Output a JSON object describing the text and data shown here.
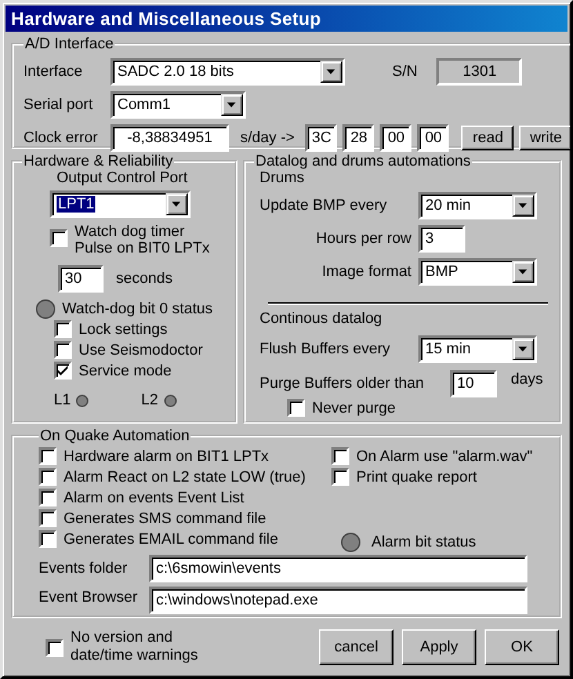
{
  "window": {
    "title": "Hardware and Miscellaneous Setup"
  },
  "ad_interface": {
    "title": "A/D Interface",
    "interface": {
      "label": "Interface",
      "value": "SADC 2.0 18 bits"
    },
    "sn": {
      "label": "S/N",
      "value": "1301"
    },
    "serial_port": {
      "label": "Serial port",
      "value": "Comm1"
    },
    "clock_error": {
      "label": "Clock error",
      "value": "-8,38834951",
      "unit": "s/day ->",
      "bytes": [
        "3C",
        "28",
        "00",
        "00"
      ]
    },
    "buttons": [
      "read",
      "write"
    ]
  },
  "hardware": {
    "title": "Hardware & Reliability",
    "port_label": "Output Control Port",
    "port_value": "LPT1",
    "watchdog": {
      "label": "Watch dog timer Pulse on BIT0 LPTx",
      "checked": false
    },
    "seconds": {
      "value": "30",
      "unit": "seconds"
    },
    "status_label": "Watch-dog bit 0 status",
    "options": [
      {
        "label": "Lock settings",
        "checked": false
      },
      {
        "label": "Use Seismodoctor",
        "checked": false
      },
      {
        "label": "Service mode",
        "checked": true
      }
    ],
    "leds": [
      "L1",
      "L2"
    ]
  },
  "datalog": {
    "title": "Datalog and drums automations",
    "drums_label": "Drums",
    "update": {
      "label": "Update BMP every",
      "value": "20 min"
    },
    "hours": {
      "label": "Hours per row",
      "value": "3"
    },
    "image_format": {
      "label": "Image format",
      "value": "BMP"
    },
    "continuous_label": "Continous datalog",
    "flush": {
      "label": "Flush Buffers every",
      "value": "15 min"
    },
    "purge": {
      "label": "Purge Buffers older than",
      "value": "10",
      "unit": "days"
    },
    "never_purge": {
      "label": "Never purge",
      "checked": false
    }
  },
  "quake": {
    "title": "On Quake Automation",
    "left_options": [
      {
        "label": "Hardware alarm on BIT1 LPTx",
        "checked": false
      },
      {
        "label": "Alarm React on L2 state LOW (true)",
        "checked": false
      },
      {
        "label": "Alarm on events Event List",
        "checked": false
      },
      {
        "label": "Generates SMS command file",
        "checked": false
      },
      {
        "label": "Generates EMAIL command file",
        "checked": false
      }
    ],
    "right_options": [
      {
        "label": "On Alarm use \"alarm.wav\"",
        "checked": false
      },
      {
        "label": "Print quake report",
        "checked": false
      }
    ],
    "status_label": "Alarm bit status",
    "events_folder": {
      "label": "Events folder",
      "value": "c:\\6smowin\\events"
    },
    "event_browser": {
      "label": "Event Browser",
      "value": "c:\\windows\\notepad.exe"
    }
  },
  "footer": {
    "warnings": {
      "label": "No version and date/time warnings",
      "checked": false
    },
    "buttons": [
      "cancel",
      "Apply",
      "OK"
    ]
  }
}
